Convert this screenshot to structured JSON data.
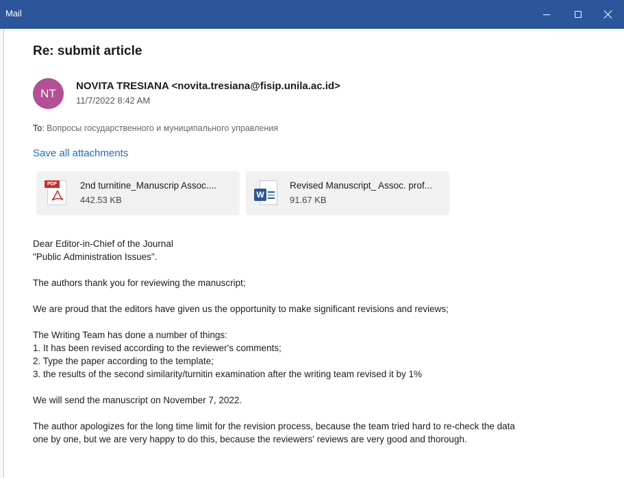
{
  "window": {
    "title": "Mail"
  },
  "message": {
    "subject": "Re: submit article",
    "avatar_initials": "NT",
    "sender": "NOVITA TRESIANA <novita.tresiana@fisip.unila.ac.id>",
    "date": "11/7/2022 8:42 AM",
    "to_label": "To:",
    "to_value": "Вопросы государственного и муниципального управления",
    "save_all_label": "Save all attachments"
  },
  "attachments": [
    {
      "name": "2nd turnitine_Manuscrip Assoc....",
      "size": "442.53 KB",
      "icon": "pdf-icon"
    },
    {
      "name": "Revised Manuscript_ Assoc. prof...",
      "size": "91.67 KB",
      "icon": "word-doc-icon"
    }
  ],
  "body": {
    "line1": "Dear Editor-in-Chief of the Journal",
    "line2": "\"Public Administration Issues\".",
    "line3": "The authors thank you for reviewing the manuscript;",
    "line4": "We are proud that the editors have given us the opportunity to make significant revisions and reviews;",
    "line5": "The Writing Team has done a number of things:",
    "line6": "1. It has been revised according to the reviewer's comments;",
    "line7": "2. Type the paper according to the template;",
    "line8": "3. the results of the second similarity/turnitin examination after the writing team revised it by 1%",
    "line9": "We will send the manuscript on November 7, 2022.",
    "line10": "The author apologizes for the long time limit for the revision process, because the team tried hard to re-check the data",
    "line11": "one by one, but we are very happy to do this, because the reviewers' reviews are very good and thorough."
  },
  "colors": {
    "titlebar": "#2b579a",
    "avatar": "#b34f96",
    "link": "#1b6ec2"
  }
}
